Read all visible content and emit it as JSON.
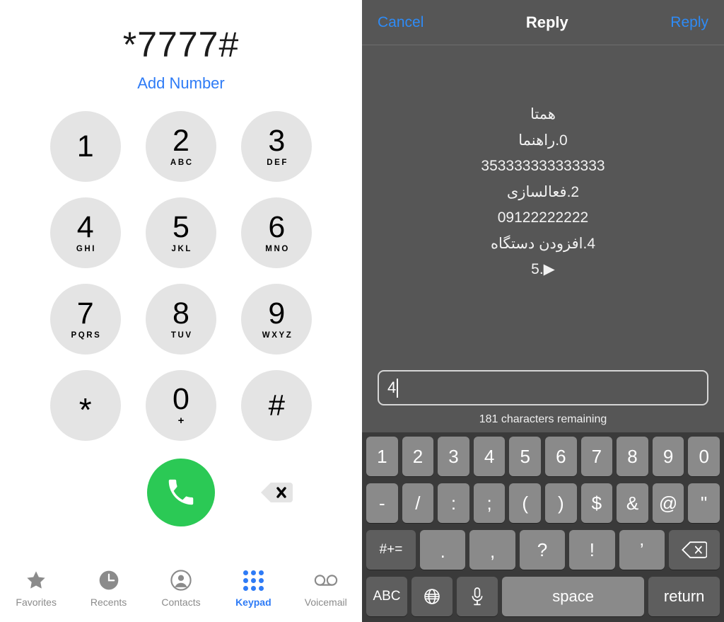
{
  "dialer": {
    "number": "*7777#",
    "add_number_label": "Add Number",
    "keys": [
      {
        "digit": "1",
        "letters": ""
      },
      {
        "digit": "2",
        "letters": "ABC"
      },
      {
        "digit": "3",
        "letters": "DEF"
      },
      {
        "digit": "4",
        "letters": "GHI"
      },
      {
        "digit": "5",
        "letters": "JKL"
      },
      {
        "digit": "6",
        "letters": "MNO"
      },
      {
        "digit": "7",
        "letters": "PQRS"
      },
      {
        "digit": "8",
        "letters": "TUV"
      },
      {
        "digit": "9",
        "letters": "WXYZ"
      },
      {
        "digit": "*",
        "letters": ""
      },
      {
        "digit": "0",
        "letters": "+"
      },
      {
        "digit": "#",
        "letters": ""
      }
    ],
    "call_button_icon": "phone-icon",
    "delete_button_icon": "backspace-icon",
    "tabs": [
      {
        "label": "Favorites",
        "icon": "star-icon",
        "active": false
      },
      {
        "label": "Recents",
        "icon": "clock-icon",
        "active": false
      },
      {
        "label": "Contacts",
        "icon": "person-circle-icon",
        "active": false
      },
      {
        "label": "Keypad",
        "icon": "keypad-dots-icon",
        "active": true
      },
      {
        "label": "Voicemail",
        "icon": "voicemail-icon",
        "active": false
      }
    ]
  },
  "reply": {
    "nav": {
      "cancel_label": "Cancel",
      "title": "Reply",
      "send_label": "Reply"
    },
    "message_lines": [
      "همتا",
      "0.راهنما",
      "353333333333333",
      "2.فعالسازی",
      "09122222222",
      "4.افزودن دستگاه",
      "5.▶"
    ],
    "input": {
      "value": "4",
      "placeholder": ""
    },
    "char_count": "181 characters remaining",
    "keyboard": {
      "row1": [
        "1",
        "2",
        "3",
        "4",
        "5",
        "6",
        "7",
        "8",
        "9",
        "0"
      ],
      "row2": [
        "-",
        "/",
        ":",
        ";",
        "(",
        ")",
        "$",
        "&",
        "@",
        "\""
      ],
      "row3_left": "#+=",
      "row3": [
        ".",
        ",",
        "?",
        "!",
        "’"
      ],
      "row3_right_icon": "backspace-icon",
      "row4": {
        "abc": "ABC",
        "globe_icon": "globe-icon",
        "mic_icon": "microphone-icon",
        "space": "space",
        "return": "return"
      }
    }
  },
  "colors": {
    "accent_blue": "#2e7bf6",
    "call_green": "#2bc955",
    "key_gray": "#e4e4e4",
    "panel_gray": "#565656",
    "keyboard_bg": "#3a3a3a",
    "keyboard_key": "#8a8a8a"
  }
}
